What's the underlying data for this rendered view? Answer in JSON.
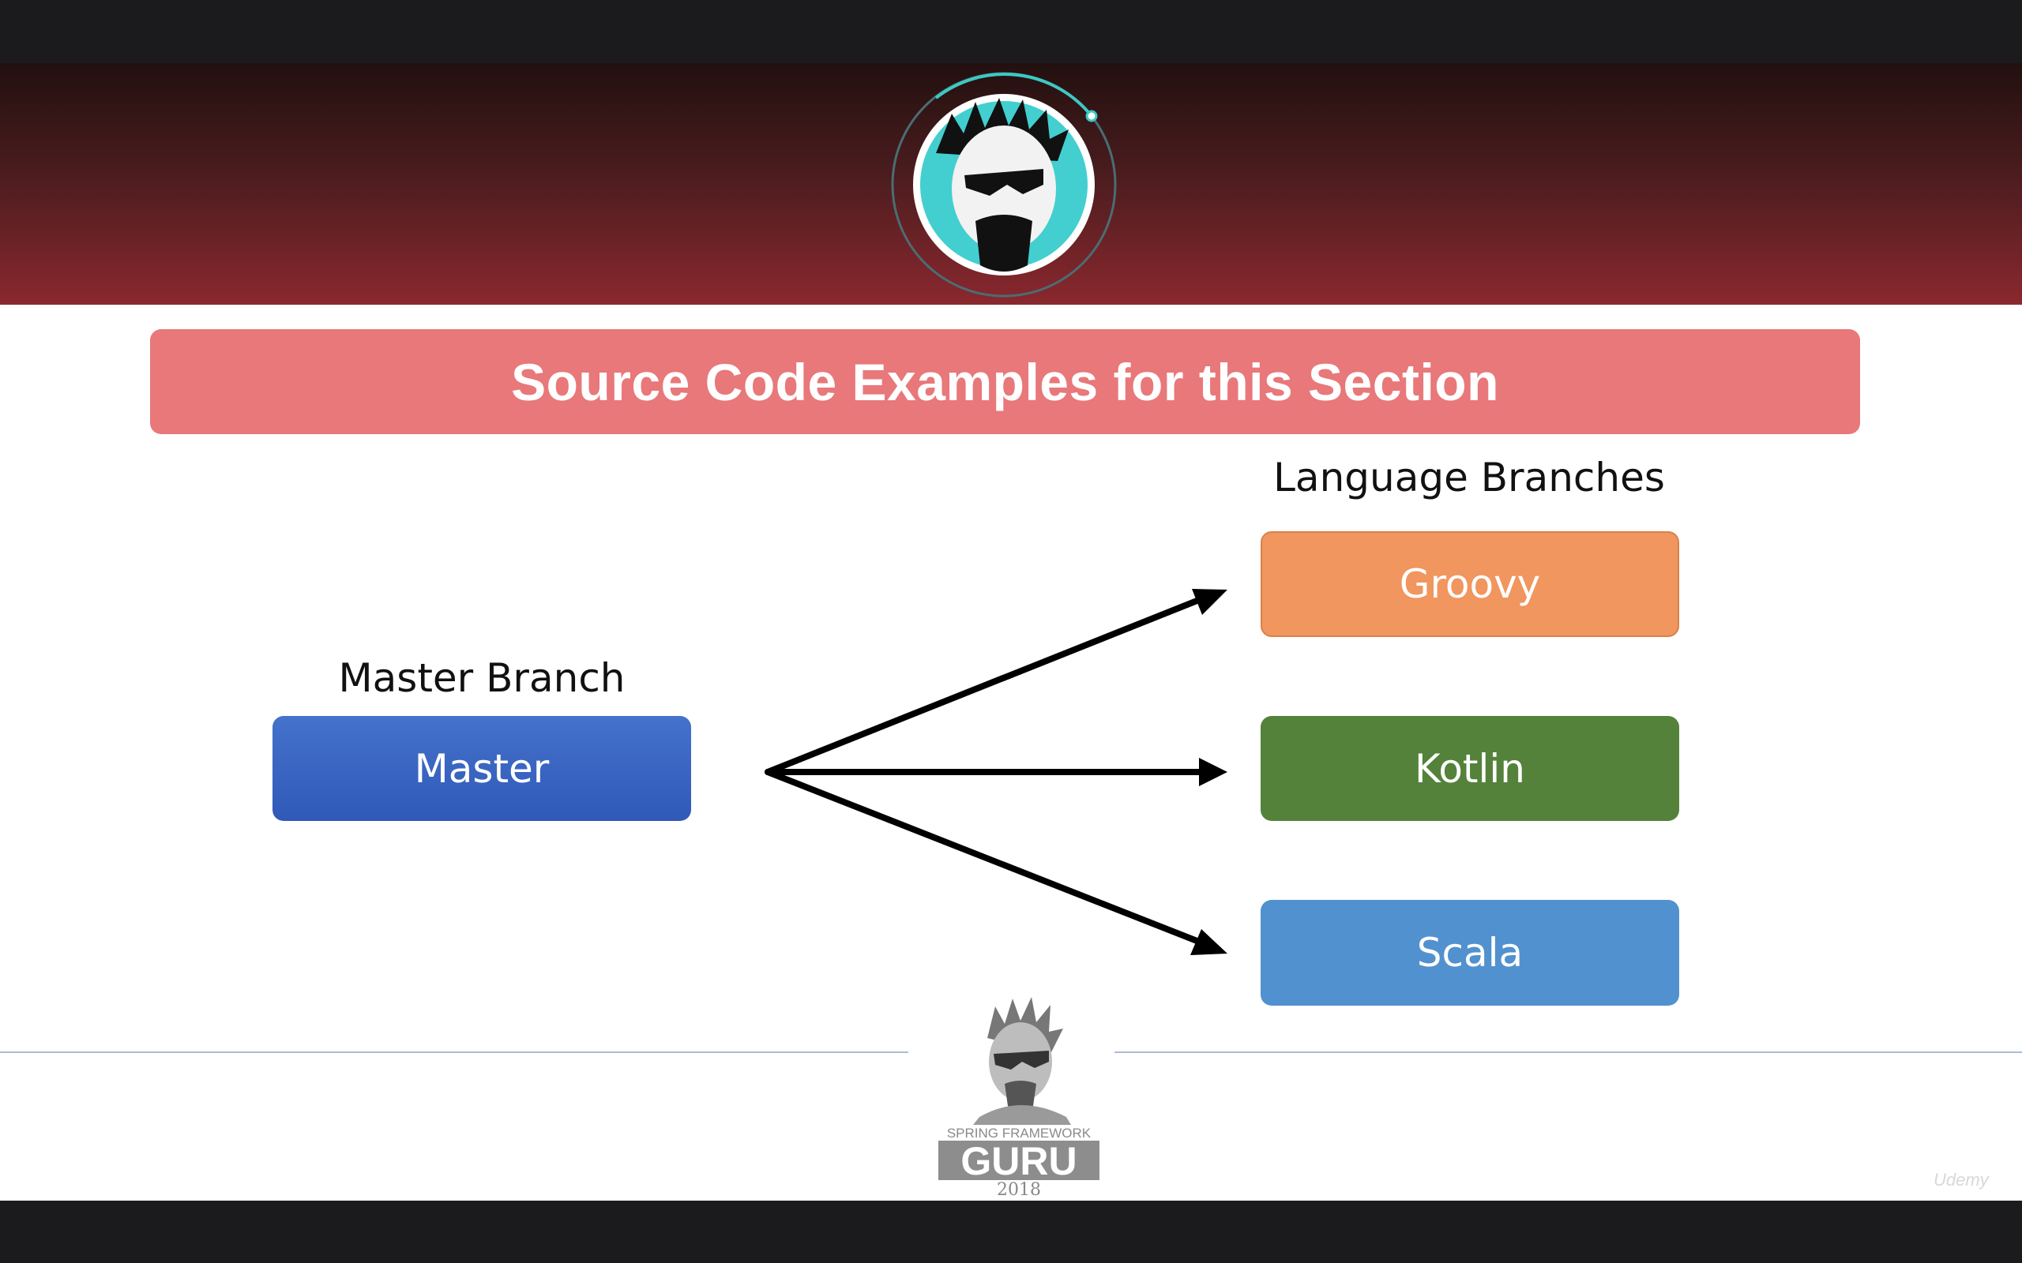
{
  "slide": {
    "title": "Source Code Examples for this Section",
    "master_label": "Master Branch",
    "language_label": "Language Branches",
    "master_box": "Master",
    "branches": [
      {
        "label": "Groovy",
        "color": "#f0965e"
      },
      {
        "label": "Kotlin",
        "color": "#54823a"
      },
      {
        "label": "Scala",
        "color": "#5291cf"
      }
    ],
    "colors": {
      "header_dark": "#22100f",
      "header_red": "#8a282e",
      "title_bar": "#e8787a",
      "master_box": "#3a63c0"
    }
  },
  "footer": {
    "brand_top": "SPRING FRAMEWORK",
    "brand_main": "GURU",
    "year": "2018",
    "watermark": "Udemy"
  },
  "icons": [
    "avatar-logo-icon",
    "guru-logo-icon",
    "arrow-icon"
  ]
}
